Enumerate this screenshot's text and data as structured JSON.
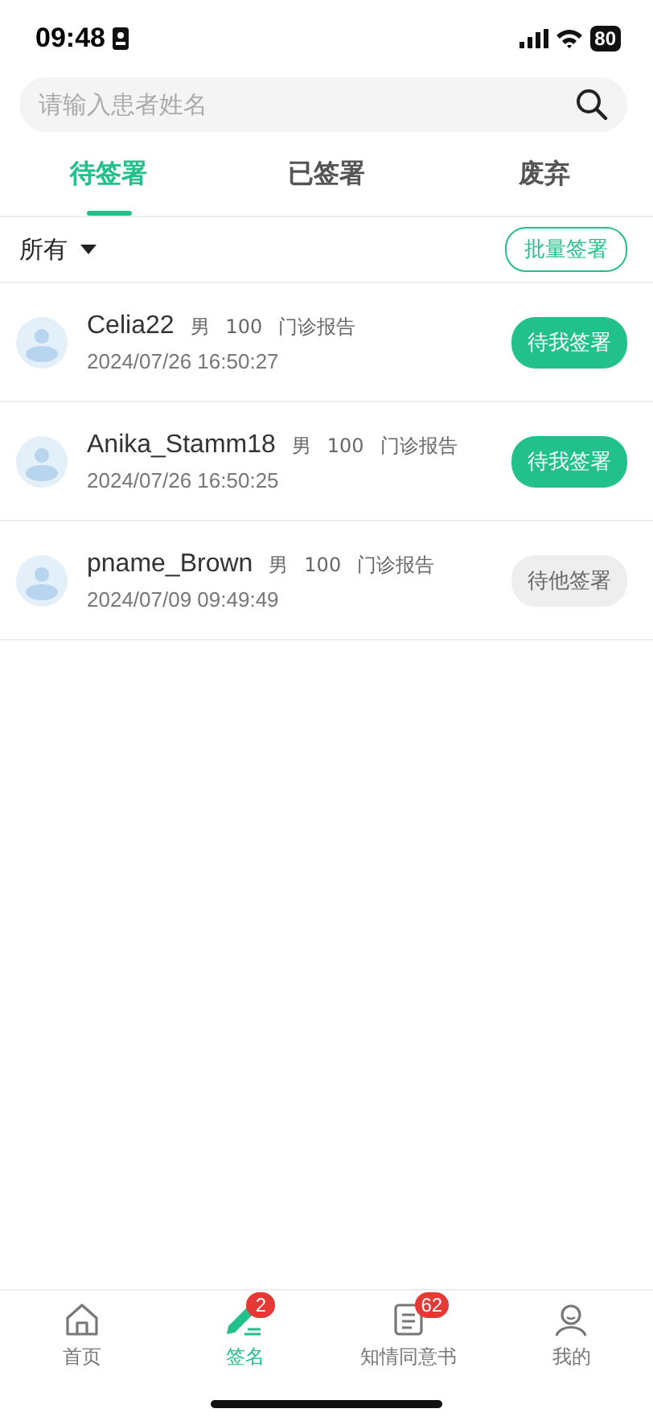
{
  "status_bar": {
    "time": "09:48",
    "battery": "80"
  },
  "search": {
    "placeholder": "请输入患者姓名"
  },
  "tabs": [
    {
      "label": "待签署",
      "selected": true
    },
    {
      "label": "已签署",
      "selected": false
    },
    {
      "label": "废弃",
      "selected": false
    }
  ],
  "filter": {
    "label": "所有",
    "batch_button": "批量签署"
  },
  "records": [
    {
      "name": "Celia22",
      "gender": "男",
      "number": "100",
      "report": "门诊报告",
      "time": "2024/07/26 16:50:27",
      "status": "待我签署",
      "kind": "mine"
    },
    {
      "name": "Anika_Stamm18",
      "gender": "男",
      "number": "100",
      "report": "门诊报告",
      "time": "2024/07/26 16:50:25",
      "status": "待我签署",
      "kind": "mine"
    },
    {
      "name": "pname_Brown",
      "gender": "男",
      "number": "100",
      "report": "门诊报告",
      "time": "2024/07/09 09:49:49",
      "status": "待他签署",
      "kind": "other"
    }
  ],
  "nav": [
    {
      "label": "首页",
      "kind": "home",
      "selected": false
    },
    {
      "label": "签名",
      "kind": "sign",
      "selected": true,
      "badge": "2"
    },
    {
      "label": "知情同意书",
      "kind": "doc",
      "selected": false,
      "badge": "62"
    },
    {
      "label": "我的",
      "kind": "user",
      "selected": false
    }
  ]
}
